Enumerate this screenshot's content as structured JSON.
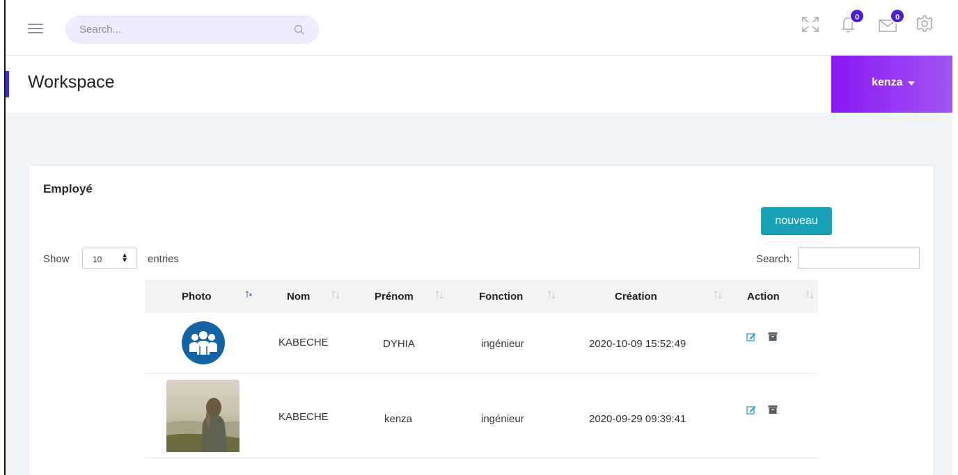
{
  "topbar": {
    "search_placeholder": "Search...",
    "notifications_count": "0",
    "messages_count": "0",
    "accent_color": "#4b1fd6"
  },
  "page": {
    "title": "Workspace",
    "user_name": "kenza",
    "user_menu_color": "#8a16f3"
  },
  "card": {
    "title": "Employé",
    "new_button": "nouveau",
    "new_button_color": "#17a2b8",
    "show_label": "Show",
    "page_length": "10",
    "entries_label": "entries",
    "search_label": "Search:"
  },
  "table": {
    "columns": [
      "Photo",
      "Nom",
      "Prénom",
      "Fonction",
      "Création",
      "Action"
    ],
    "sorted_column": "Photo",
    "rows": [
      {
        "photo": "group-avatar-icon",
        "nom": "KABECHE",
        "prenom": "DYHIA",
        "fonction": "ingénieur",
        "creation": "2020-10-09 15:52:49"
      },
      {
        "photo": "profile-photo",
        "nom": "KABECHE",
        "prenom": "kenza",
        "fonction": "ingénieur",
        "creation": "2020-09-29 09:39:41"
      }
    ],
    "action_icons": [
      "edit-icon",
      "archive-icon"
    ]
  }
}
